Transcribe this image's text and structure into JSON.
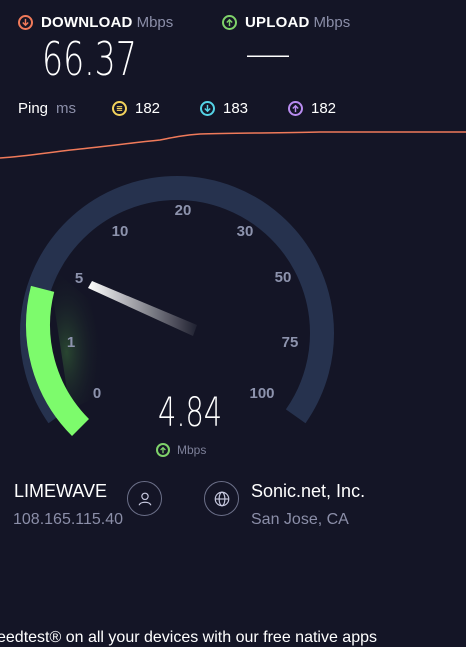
{
  "download": {
    "label": "DOWNLOAD",
    "unit": "Mbps",
    "value": "66.37"
  },
  "upload": {
    "label": "UPLOAD",
    "unit": "Mbps",
    "value": "——"
  },
  "ping": {
    "label": "Ping",
    "unit": "ms",
    "idle": "182",
    "download": "183",
    "upload": "182"
  },
  "gauge": {
    "ticks": [
      "0",
      "1",
      "5",
      "10",
      "20",
      "30",
      "50",
      "75",
      "100"
    ],
    "current_value": "4.84",
    "unit": "Mbps",
    "fill_fraction": 0.22
  },
  "provider": {
    "name": "LIMEWAVE",
    "ip": "108.165.115.40"
  },
  "server": {
    "name": "Sonic.net, Inc.",
    "location": "San Jose, CA"
  },
  "footer": {
    "text": "eedtest® on all your devices with our free native apps"
  },
  "colors": {
    "background": "#141526",
    "download_accent": "#f07a5a",
    "upload_accent": "#7fd26a",
    "ping_idle": "#f3d35c",
    "ping_download": "#55d3e6",
    "ping_upload": "#b98cf0",
    "gauge_track": "#26324e",
    "gauge_fill": "#7dfb6c"
  }
}
